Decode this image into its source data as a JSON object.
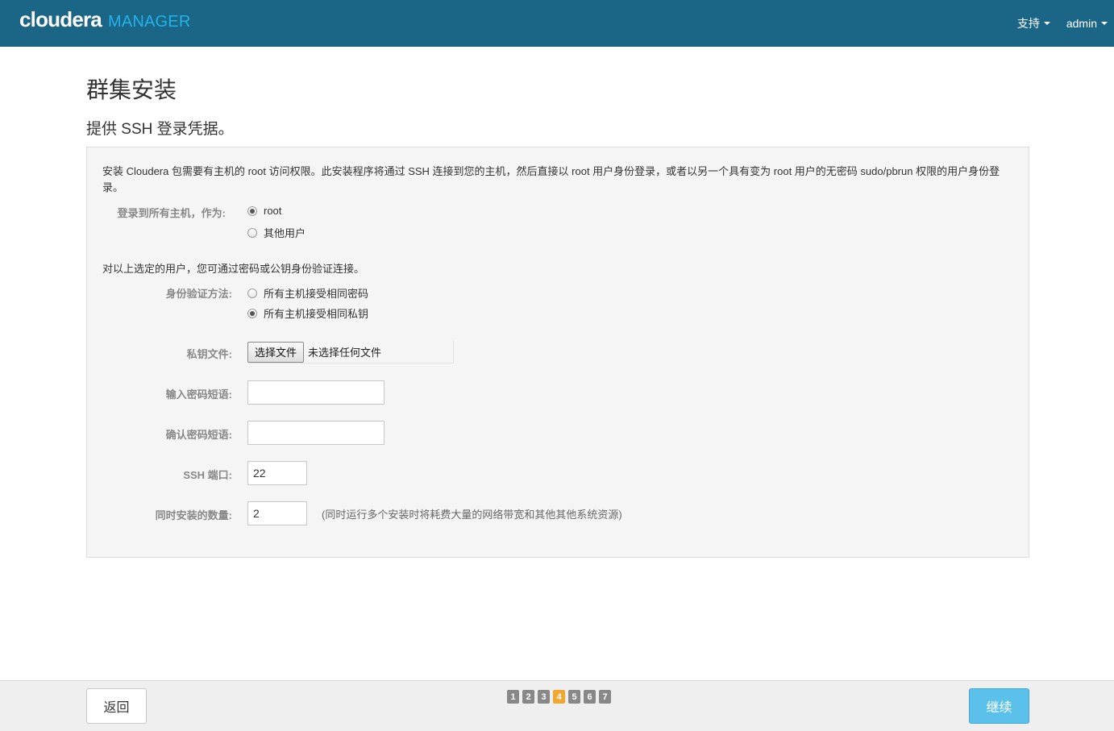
{
  "header": {
    "brand_main": "cloudera",
    "brand_sub": "MANAGER",
    "nav": [
      {
        "label": "支持"
      },
      {
        "label": "admin"
      }
    ]
  },
  "page": {
    "title": "群集安装",
    "subtitle": "提供 SSH 登录凭据。"
  },
  "form": {
    "intro": "安装 Cloudera 包需要有主机的 root 访问权限。此安装程序将通过 SSH 连接到您的主机，然后直接以 root 用户身份登录，或者以另一个具有变为 root 用户的无密码 sudo/pbrun 权限的用户身份登录。",
    "login_as": {
      "label": "登录到所有主机，作为:",
      "options": [
        {
          "label": "root",
          "checked": true
        },
        {
          "label": "其他用户",
          "checked": false
        }
      ]
    },
    "auth_intro": "对以上选定的用户，您可通过密码或公钥身份验证连接。",
    "auth_method": {
      "label": "身份验证方法:",
      "options": [
        {
          "label": "所有主机接受相同密码",
          "checked": false
        },
        {
          "label": "所有主机接受相同私钥",
          "checked": true
        }
      ]
    },
    "private_key": {
      "label": "私钥文件:",
      "button": "选择文件",
      "status": "未选择任何文件"
    },
    "passphrase": {
      "label": "输入密码短语:",
      "value": ""
    },
    "confirm_passphrase": {
      "label": "确认密码短语:",
      "value": ""
    },
    "ssh_port": {
      "label": "SSH 端口:",
      "value": "22"
    },
    "parallel": {
      "label": "同时安装的数量:",
      "value": "2",
      "hint": "(同时运行多个安装时将耗费大量的网络带宽和其他其他系统资源)"
    }
  },
  "footer": {
    "back_label": "返回",
    "continue_label": "继续",
    "steps": [
      "1",
      "2",
      "3",
      "4",
      "5",
      "6",
      "7"
    ],
    "active_step": 4
  },
  "colors": {
    "topbar": "#1b6587",
    "brand_sub": "#22b3ea",
    "continue_button": "#5bc0ea",
    "active_step": "#f0a830",
    "inactive_step": "#888888"
  }
}
